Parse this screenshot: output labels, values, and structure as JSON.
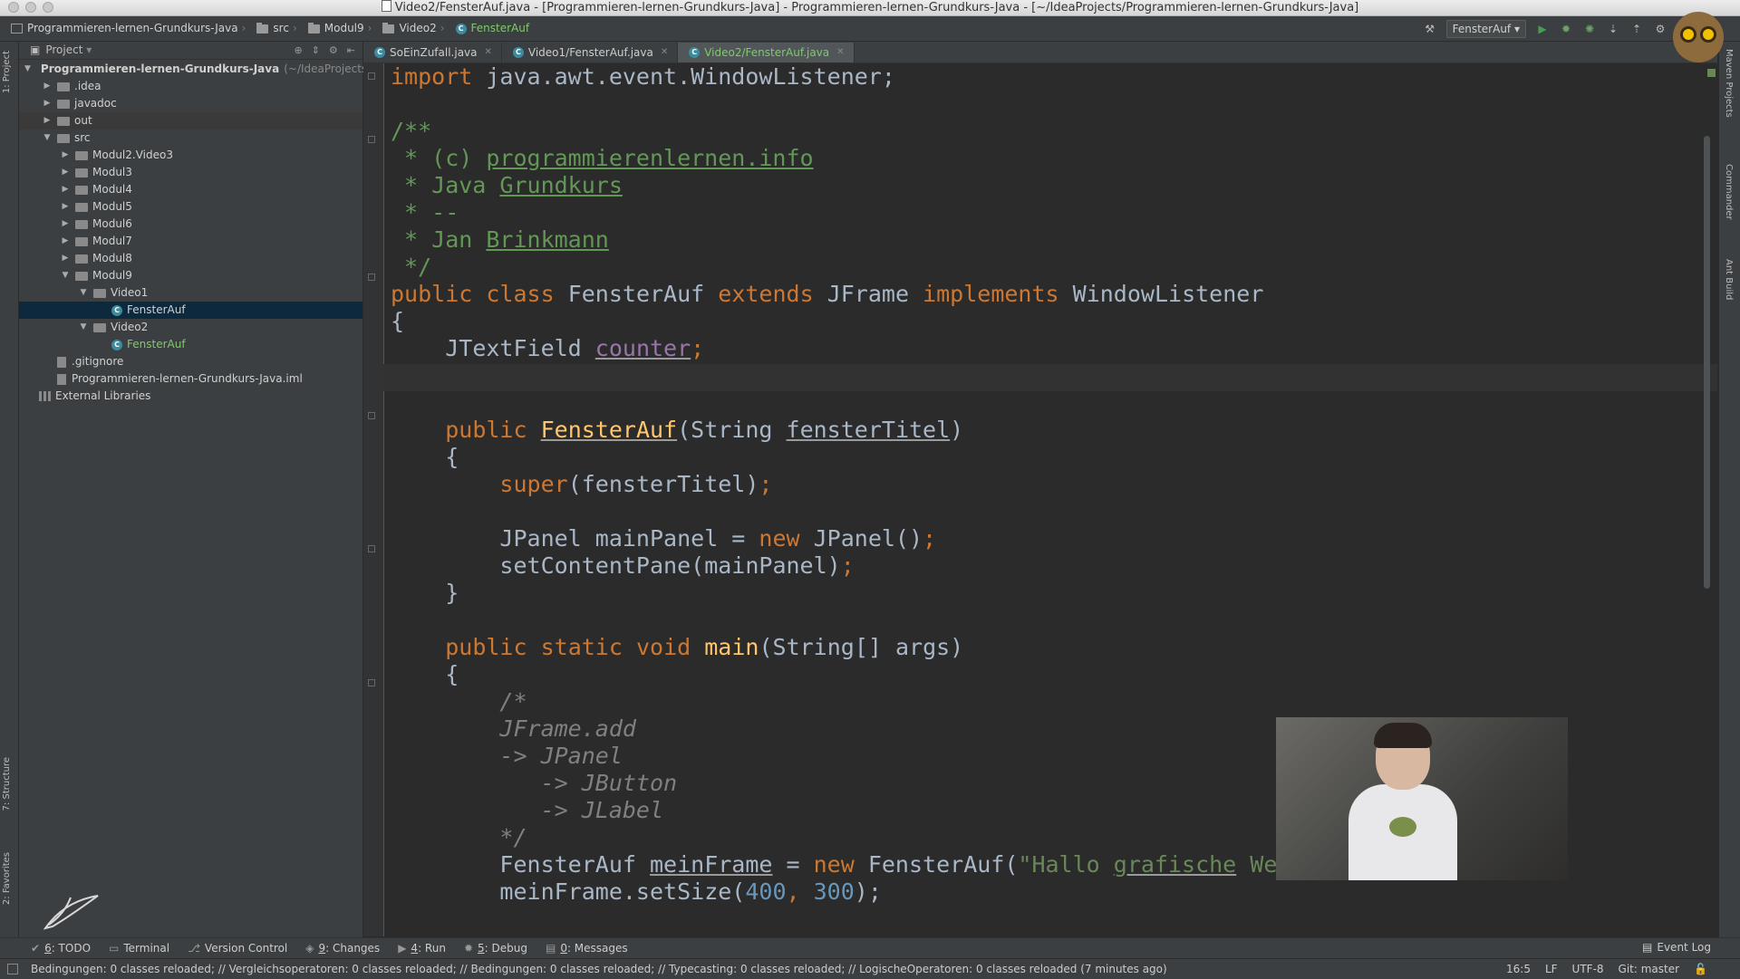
{
  "window": {
    "title": "Video2/FensterAuf.java - [Programmieren-lernen-Grundkurs-Java] - Programmieren-lernen-Grundkurs-Java - [~/IdeaProjects/Programmieren-lernen-Grundkurs-Java]"
  },
  "breadcrumbs": [
    "Programmieren-lernen-Grundkurs-Java",
    "src",
    "Modul9",
    "Video2",
    "FensterAuf"
  ],
  "run_config": "FensterAuf",
  "left_stripe": {
    "project_tab": "1: Project",
    "structure_tab": "7: Structure",
    "favorites_tab": "2: Favorites"
  },
  "right_stripe": [
    "Maven Projects",
    "Commander",
    "Ant Build"
  ],
  "project_panel": {
    "header": "Project",
    "tree": [
      {
        "label": "Programmieren-lernen-Grundkurs-Java",
        "suffix": "(~/IdeaProjects/P",
        "depth": 0,
        "expanded": true
      },
      {
        "label": ".idea",
        "depth": 1,
        "expanded": false
      },
      {
        "label": "javadoc",
        "depth": 1,
        "expanded": false
      },
      {
        "label": "out",
        "depth": 1,
        "expanded": false
      },
      {
        "label": "src",
        "depth": 1,
        "expanded": true
      },
      {
        "label": "Modul2.Video3",
        "depth": 2,
        "expanded": false
      },
      {
        "label": "Modul3",
        "depth": 2,
        "expanded": false
      },
      {
        "label": "Modul4",
        "depth": 2,
        "expanded": false
      },
      {
        "label": "Modul5",
        "depth": 2,
        "expanded": false
      },
      {
        "label": "Modul6",
        "depth": 2,
        "expanded": false
      },
      {
        "label": "Modul7",
        "depth": 2,
        "expanded": false
      },
      {
        "label": "Modul8",
        "depth": 2,
        "expanded": false
      },
      {
        "label": "Modul9",
        "depth": 2,
        "expanded": true
      },
      {
        "label": "Video1",
        "depth": 3,
        "expanded": true
      },
      {
        "label": "FensterAuf",
        "depth": 4,
        "type": "class",
        "selected": true
      },
      {
        "label": "Video2",
        "depth": 3,
        "expanded": true
      },
      {
        "label": "FensterAuf",
        "depth": 4,
        "type": "class",
        "current": true
      },
      {
        "label": ".gitignore",
        "depth": 1,
        "type": "file"
      },
      {
        "label": "Programmieren-lernen-Grundkurs-Java.iml",
        "depth": 1,
        "type": "file"
      },
      {
        "label": "External Libraries",
        "depth": 0,
        "type": "lib"
      }
    ]
  },
  "editor_tabs": [
    {
      "label": "SoEinZufall.java",
      "active": false
    },
    {
      "label": "Video1/FensterAuf.java",
      "active": false
    },
    {
      "label": "Video2/FensterAuf.java",
      "active": true
    }
  ],
  "code": {
    "import": "import",
    "import_rest": " java.awt.event.WindowListener;",
    "doc_open": "/**",
    "doc_c": " * (c) ",
    "doc_site": "programmierenlernen.info",
    "doc_java": " * Java ",
    "doc_kurs": "Grundkurs",
    "doc_dash": " * --",
    "doc_jan": " * Jan ",
    "doc_name": "Brinkmann",
    "doc_close": " */",
    "kw_public": "public",
    "kw_class": "class",
    "class_name": "FensterAuf",
    "kw_extends": "extends",
    "jframe": "JFrame",
    "kw_implements": "implements",
    "iface": "WindowListener",
    "brace_open": "{",
    "brace_close": "}",
    "jtext": "JTextField",
    "counter": "counter",
    "semi": ";",
    "ctor_name": "FensterAuf",
    "ctor_paren": "(String ",
    "ctor_param": "fensterTitel",
    "ctor_close": ")",
    "kw_super": "super",
    "super_args": "(fensterTitel)",
    "jpanel_decl": "JPanel mainPanel = ",
    "kw_new": "new",
    "jpanel_new": " JPanel()",
    "setcontent": "setContentPane(mainPanel)",
    "kw_static": "static",
    "kw_void": "void",
    "main_name": "main",
    "main_args": "(String[] args)",
    "bc_open": "/*",
    "bc_1": "JFrame.add",
    "bc_2": "-> JPanel",
    "bc_3": "   -> JButton",
    "bc_4": "   -> JLabel",
    "bc_close": "*/",
    "frame_decl": "FensterAuf ",
    "frame_var": "meinFrame",
    "frame_eq": " = ",
    "frame_new": " FensterAuf(",
    "frame_str_a": "\"Hallo ",
    "frame_str_b": "grafische",
    "frame_str_c": " We",
    "setsize": "meinFrame.setSize(",
    "n400": "400",
    "comma": ", ",
    "n300": "300",
    "setsize_end": ");"
  },
  "tool_windows": [
    {
      "key": "6",
      "label": ": TODO"
    },
    {
      "key": "",
      "label": "Terminal"
    },
    {
      "key": "",
      "label": "Version Control"
    },
    {
      "key": "9",
      "label": ": Changes"
    },
    {
      "key": "4",
      "label": ": Run"
    },
    {
      "key": "5",
      "label": ": Debug"
    },
    {
      "key": "0",
      "label": ": Messages"
    }
  ],
  "event_log": "Event Log",
  "status": {
    "message": "Bedingungen: 0 classes reloaded; // Vergleichsoperatoren: 0 classes reloaded; // Bedingungen: 0 classes reloaded; // Typecasting: 0 classes reloaded; // LogischeOperatoren: 0 classes reloaded (7 minutes ago)",
    "position": "16:5",
    "line_sep": "LF",
    "encoding": "UTF-8",
    "vcs": "Git: master"
  },
  "colors": {
    "background": "#2b2b2b",
    "panel": "#3c3f41",
    "keyword": "#cc7832",
    "comment": "#629755",
    "function": "#ffc66d",
    "number": "#6897bb",
    "string": "#6a8759"
  }
}
